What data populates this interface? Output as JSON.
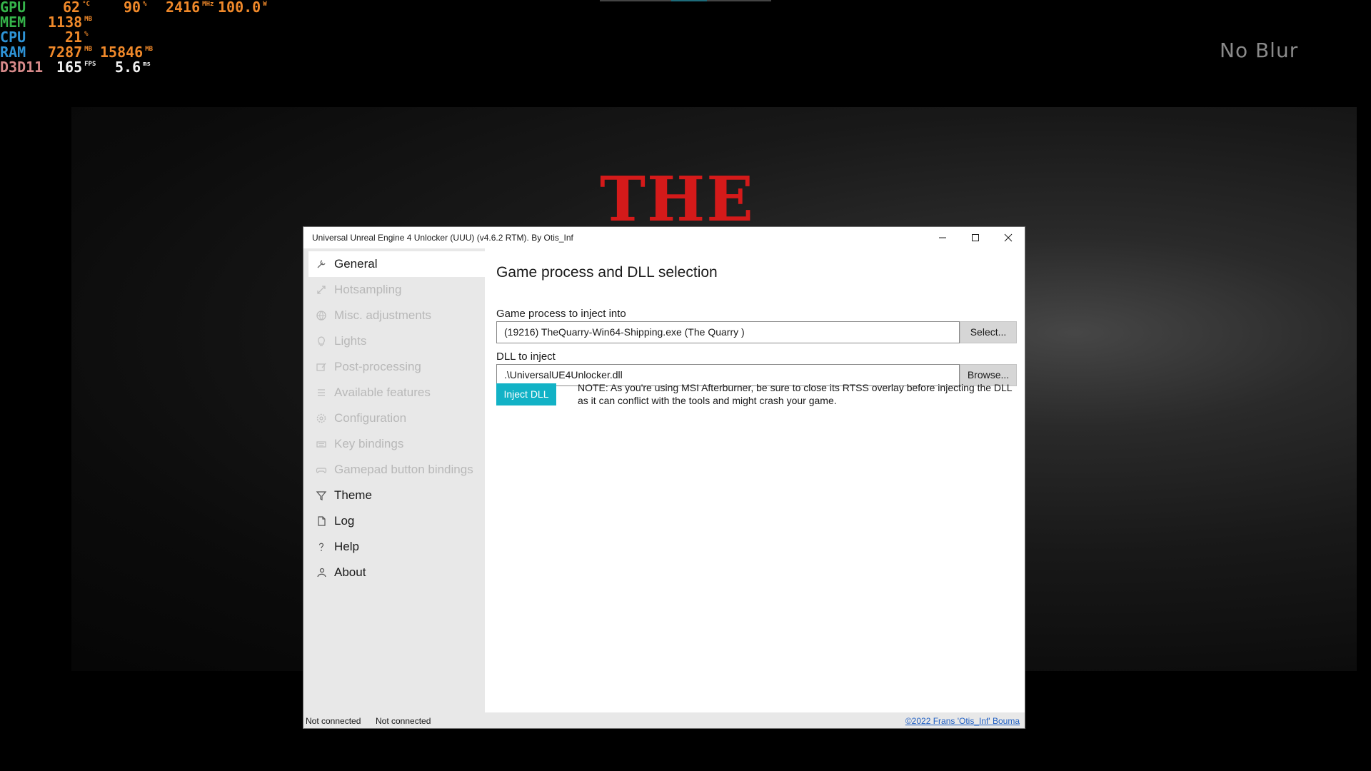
{
  "osd": {
    "rows": [
      {
        "key": "GPU",
        "key_color": "#35b34a",
        "values": [
          {
            "v": "62",
            "unit": "°C"
          },
          {
            "v": "90",
            "unit": "%"
          },
          {
            "v": "2416",
            "unit": "MHz"
          },
          {
            "v": "100.0",
            "unit": "W"
          }
        ]
      },
      {
        "key": "MEM",
        "key_color": "#35b34a",
        "values": [
          {
            "v": "1138",
            "unit": "MB"
          }
        ]
      },
      {
        "key": "CPU",
        "key_color": "#2e93d6",
        "values": [
          {
            "v": "21",
            "unit": "%"
          }
        ]
      },
      {
        "key": "RAM",
        "key_color": "#2e93d6",
        "values": [
          {
            "v": "7287",
            "unit": "MB"
          },
          {
            "v": "15846",
            "unit": "MB"
          }
        ]
      },
      {
        "key": "D3D11",
        "key_color": "#d88a8a",
        "values": [
          {
            "v": "165",
            "unit": "FPS"
          },
          {
            "v": "5.6",
            "unit": "ms"
          }
        ]
      }
    ]
  },
  "background": {
    "overlay_label": "No Blur",
    "logo_text": "THE"
  },
  "window": {
    "title": "Universal Unreal Engine 4 Unlocker (UUU) (v4.6.2 RTM). By Otis_Inf",
    "controls": {
      "minimize_icon": "minimize-icon",
      "maximize_icon": "maximize-icon",
      "close_icon": "close-icon"
    }
  },
  "sidebar": {
    "items": [
      {
        "label": "General",
        "icon": "wrench-icon",
        "state": "active"
      },
      {
        "label": "Hotsampling",
        "icon": "resize-icon",
        "state": "disabled"
      },
      {
        "label": "Misc. adjustments",
        "icon": "globe-icon",
        "state": "disabled"
      },
      {
        "label": "Lights",
        "icon": "lightbulb-icon",
        "state": "disabled"
      },
      {
        "label": "Post-processing",
        "icon": "photo-edit-icon",
        "state": "disabled"
      },
      {
        "label": "Available features",
        "icon": "list-icon",
        "state": "disabled"
      },
      {
        "label": "Configuration",
        "icon": "gear-icon",
        "state": "disabled"
      },
      {
        "label": "Key bindings",
        "icon": "keyboard-icon",
        "state": "disabled"
      },
      {
        "label": "Gamepad button bindings",
        "icon": "gamepad-icon",
        "state": "disabled"
      },
      {
        "label": "Theme",
        "icon": "filter-icon",
        "state": "enabled"
      },
      {
        "label": "Log",
        "icon": "document-icon",
        "state": "enabled"
      },
      {
        "label": "Help",
        "icon": "question-icon",
        "state": "enabled"
      },
      {
        "label": "About",
        "icon": "person-icon",
        "state": "enabled"
      }
    ]
  },
  "main": {
    "heading": "Game process and DLL selection",
    "process_label": "Game process to inject into",
    "process_value": "(19216) TheQuarry-Win64-Shipping.exe (The Quarry  )",
    "select_button": "Select...",
    "dll_label": "DLL to inject",
    "dll_value": ".\\UniversalUE4Unlocker.dll",
    "browse_button": "Browse...",
    "inject_button": "Inject DLL",
    "note": "NOTE: As you're using MSI Afterburner, be sure to close its RTSS overlay before injecting the DLL as it can conflict with the tools and might crash your game."
  },
  "statusbar": {
    "status1": "Not connected",
    "status2": "Not connected",
    "copyright": "©2022 Frans 'Otis_Inf' Bouma"
  },
  "colors": {
    "accent": "#12b2c6",
    "sidebar_bg": "#e8e8e8",
    "link": "#1f5fc4",
    "osd_value": "#f0892a",
    "osd_fps": "#f2f2f2"
  }
}
